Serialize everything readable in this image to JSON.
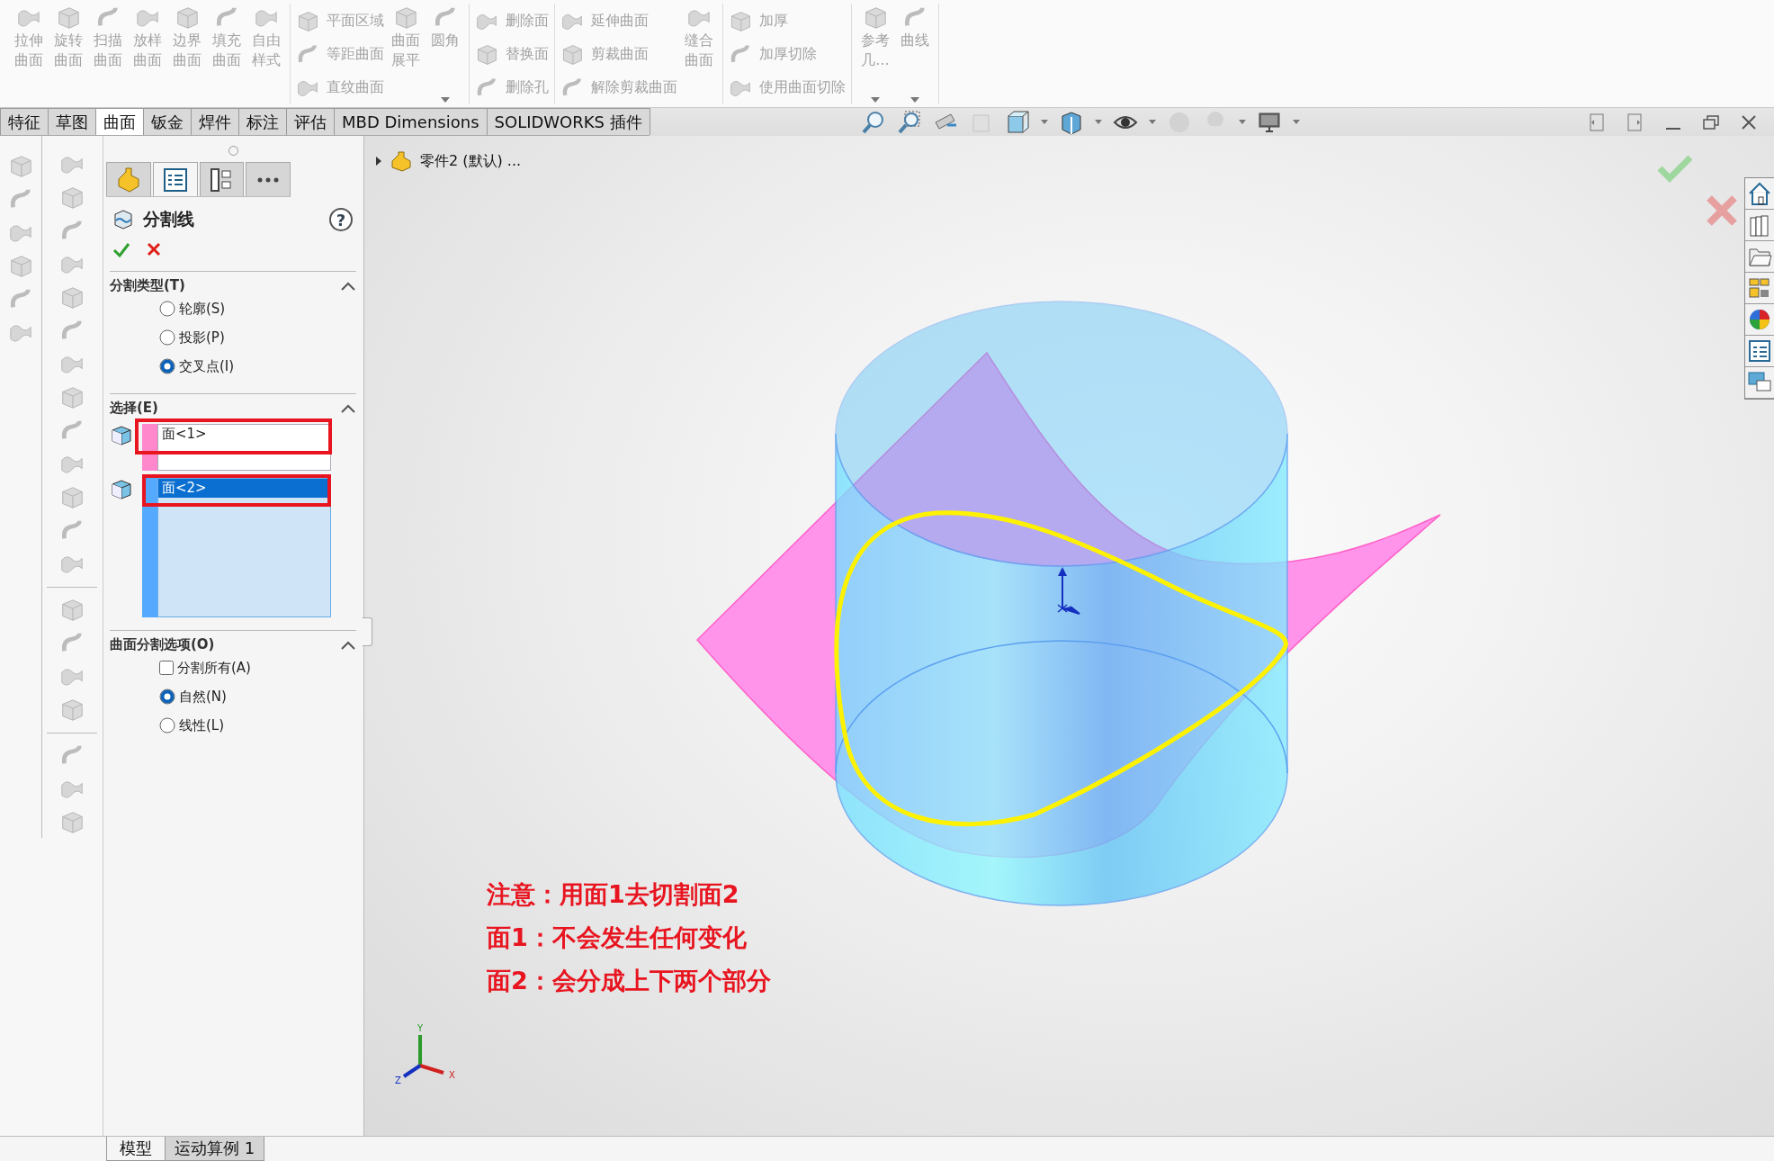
{
  "toolbar": {
    "groups": [
      {
        "items": [
          {
            "kind": "large",
            "lines": [
              "拉伸",
              "曲面"
            ],
            "disabled": true,
            "dropdown": false
          },
          {
            "kind": "large",
            "lines": [
              "旋转",
              "曲面"
            ],
            "disabled": true,
            "dropdown": false
          },
          {
            "kind": "large",
            "lines": [
              "扫描",
              "曲面"
            ],
            "disabled": true,
            "dropdown": false
          },
          {
            "kind": "large",
            "lines": [
              "放样",
              "曲面"
            ],
            "disabled": true,
            "dropdown": false
          },
          {
            "kind": "large",
            "lines": [
              "边界",
              "曲面"
            ],
            "disabled": true,
            "dropdown": false
          },
          {
            "kind": "large",
            "lines": [
              "填充",
              "曲面"
            ],
            "disabled": true,
            "dropdown": false
          },
          {
            "kind": "large",
            "lines": [
              "自由",
              "样式"
            ],
            "disabled": true,
            "dropdown": false
          }
        ]
      },
      {
        "items": [
          {
            "kind": "stack",
            "labels": [
              "平面区域",
              "等距曲面",
              "直纹曲面"
            ],
            "disabled": true
          },
          {
            "kind": "large",
            "lines": [
              "曲面",
              "展平"
            ],
            "disabled": true,
            "dropdown": false
          },
          {
            "kind": "large",
            "lines": [
              "圆角"
            ],
            "disabled": true,
            "dropdown": true
          }
        ]
      },
      {
        "items": [
          {
            "kind": "stack",
            "labels": [
              "删除面",
              "替换面",
              "删除孔"
            ],
            "disabled": true
          }
        ]
      },
      {
        "items": [
          {
            "kind": "stack",
            "labels": [
              "延伸曲面",
              "剪裁曲面",
              "解除剪裁曲面"
            ],
            "disabled": true
          },
          {
            "kind": "large",
            "lines": [
              "缝合",
              "曲面"
            ],
            "disabled": true,
            "dropdown": false
          }
        ]
      },
      {
        "items": [
          {
            "kind": "stack",
            "labels": [
              "加厚",
              "加厚切除",
              "使用曲面切除"
            ],
            "disabled": true
          }
        ]
      },
      {
        "items": [
          {
            "kind": "large",
            "lines": [
              "参考",
              "几..."
            ],
            "disabled": true,
            "dropdown": true
          },
          {
            "kind": "large",
            "lines": [
              "曲线"
            ],
            "disabled": true,
            "dropdown": true
          }
        ]
      }
    ]
  },
  "cmd_tabs": [
    {
      "label": "特征",
      "selected": false
    },
    {
      "label": "草图",
      "selected": false
    },
    {
      "label": "曲面",
      "selected": true
    },
    {
      "label": "钣金",
      "selected": false
    },
    {
      "label": "焊件",
      "selected": false
    },
    {
      "label": "标注",
      "selected": false
    },
    {
      "label": "评估",
      "selected": false
    },
    {
      "label": "MBD Dimensions",
      "selected": false
    },
    {
      "label": "SOLIDWORKS 插件",
      "selected": false
    }
  ],
  "panel": {
    "tabs": [
      {
        "kind": "feature",
        "selected": false
      },
      {
        "kind": "property",
        "selected": true
      },
      {
        "kind": "config",
        "selected": false
      },
      {
        "kind": "more",
        "selected": false
      }
    ],
    "title": "分割线",
    "help": "?",
    "sections": [
      {
        "title": "分割类型(T)",
        "expanded": true,
        "options": [
          {
            "kind": "radio",
            "label": "轮廓(S)",
            "checked": false
          },
          {
            "kind": "radio",
            "label": "投影(P)",
            "checked": false
          },
          {
            "kind": "radio",
            "label": "交叉点(I)",
            "checked": true
          }
        ]
      },
      {
        "title": "选择(E)",
        "expanded": true,
        "selections": [
          {
            "color": "#ff88cc",
            "active": false,
            "highlighted": true,
            "items": [
              {
                "label": "面<1>",
                "selected": false
              }
            ]
          },
          {
            "color": "#55aaff",
            "active": true,
            "highlighted": true,
            "items": [
              {
                "label": "面<2>",
                "selected": true
              }
            ]
          }
        ]
      },
      {
        "title": "曲面分割选项(O)",
        "expanded": true,
        "options": [
          {
            "kind": "checkbox",
            "label": "分割所有(A)",
            "checked": false
          },
          {
            "kind": "radio",
            "label": "自然(N)",
            "checked": true
          },
          {
            "kind": "radio",
            "label": "线性(L)",
            "checked": false
          }
        ]
      }
    ]
  },
  "viewport": {
    "tree_item": "零件2 (默认) ...",
    "notes": [
      "注意：用面1去切割面2",
      "面1：不会发生任何变化",
      "面2：会分成上下两个部分"
    ],
    "axes": [
      "X",
      "Y",
      "Z"
    ]
  },
  "bottom_tabs": [
    {
      "label": "模型",
      "selected": true
    },
    {
      "label": "运动算例 1",
      "selected": false
    }
  ]
}
